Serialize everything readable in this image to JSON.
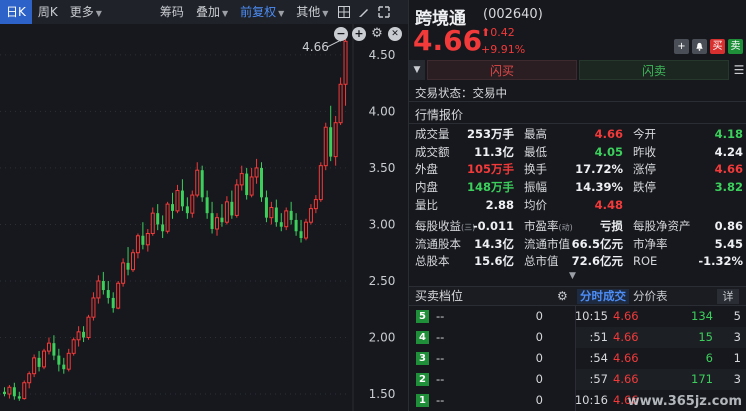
{
  "toolbar": {
    "items": [
      {
        "label": "日K",
        "active": true
      },
      {
        "label": "周K",
        "active": false
      },
      {
        "label": "更多",
        "dropdown": true
      }
    ],
    "mid_items": [
      {
        "label": "筹码"
      },
      {
        "label": "叠加",
        "dropdown": true
      },
      {
        "label": "前复权",
        "dropdown": true,
        "highlight": true
      },
      {
        "label": "其他",
        "dropdown": true
      }
    ],
    "icons": [
      "grid-icon",
      "pen-icon",
      "expand-icon"
    ]
  },
  "chart_data": {
    "type": "candlestick",
    "ylim": [
      1.35,
      4.72
    ],
    "y_ticks": [
      "4.50",
      "4.00",
      "3.50",
      "3.00",
      "2.50",
      "2.00",
      "1.50"
    ],
    "y_tick_values": [
      4.5,
      4.0,
      3.5,
      3.0,
      2.5,
      2.0,
      1.5
    ],
    "max_label": "4.66",
    "max_value": 4.66,
    "candles": [
      {
        "o": 1.52,
        "h": 1.56,
        "l": 1.48,
        "c": 1.5
      },
      {
        "o": 1.5,
        "h": 1.58,
        "l": 1.46,
        "c": 1.56
      },
      {
        "o": 1.56,
        "h": 1.6,
        "l": 1.45,
        "c": 1.48
      },
      {
        "o": 1.48,
        "h": 1.52,
        "l": 1.44,
        "c": 1.46
      },
      {
        "o": 1.46,
        "h": 1.62,
        "l": 1.45,
        "c": 1.6
      },
      {
        "o": 1.6,
        "h": 1.7,
        "l": 1.55,
        "c": 1.68
      },
      {
        "o": 1.68,
        "h": 1.85,
        "l": 1.65,
        "c": 1.82
      },
      {
        "o": 1.82,
        "h": 1.88,
        "l": 1.7,
        "c": 1.74
      },
      {
        "o": 1.74,
        "h": 1.9,
        "l": 1.72,
        "c": 1.88
      },
      {
        "o": 1.88,
        "h": 2.0,
        "l": 1.85,
        "c": 1.95
      },
      {
        "o": 1.95,
        "h": 2.02,
        "l": 1.8,
        "c": 1.84
      },
      {
        "o": 1.84,
        "h": 1.9,
        "l": 1.7,
        "c": 1.76
      },
      {
        "o": 1.76,
        "h": 1.82,
        "l": 1.68,
        "c": 1.72
      },
      {
        "o": 1.72,
        "h": 1.9,
        "l": 1.7,
        "c": 1.86
      },
      {
        "o": 1.86,
        "h": 2.0,
        "l": 1.84,
        "c": 1.98
      },
      {
        "o": 1.98,
        "h": 2.1,
        "l": 1.92,
        "c": 2.05
      },
      {
        "o": 2.05,
        "h": 2.1,
        "l": 1.96,
        "c": 2.0
      },
      {
        "o": 2.0,
        "h": 2.2,
        "l": 1.98,
        "c": 2.18
      },
      {
        "o": 2.18,
        "h": 2.4,
        "l": 2.15,
        "c": 2.35
      },
      {
        "o": 2.35,
        "h": 2.55,
        "l": 2.3,
        "c": 2.5
      },
      {
        "o": 2.5,
        "h": 2.58,
        "l": 2.38,
        "c": 2.42
      },
      {
        "o": 2.42,
        "h": 2.5,
        "l": 2.3,
        "c": 2.35
      },
      {
        "o": 2.35,
        "h": 2.4,
        "l": 2.22,
        "c": 2.26
      },
      {
        "o": 2.26,
        "h": 2.5,
        "l": 2.25,
        "c": 2.48
      },
      {
        "o": 2.48,
        "h": 2.7,
        "l": 2.45,
        "c": 2.66
      },
      {
        "o": 2.66,
        "h": 2.8,
        "l": 2.55,
        "c": 2.6
      },
      {
        "o": 2.6,
        "h": 2.78,
        "l": 2.58,
        "c": 2.75
      },
      {
        "o": 2.75,
        "h": 2.92,
        "l": 2.7,
        "c": 2.9
      },
      {
        "o": 2.9,
        "h": 3.02,
        "l": 2.78,
        "c": 2.82
      },
      {
        "o": 2.82,
        "h": 2.96,
        "l": 2.76,
        "c": 2.92
      },
      {
        "o": 2.92,
        "h": 3.15,
        "l": 2.9,
        "c": 3.1
      },
      {
        "o": 3.1,
        "h": 3.18,
        "l": 2.95,
        "c": 3.0
      },
      {
        "o": 3.0,
        "h": 3.08,
        "l": 2.88,
        "c": 2.94
      },
      {
        "o": 2.94,
        "h": 3.2,
        "l": 2.92,
        "c": 3.18
      },
      {
        "o": 3.18,
        "h": 3.28,
        "l": 3.05,
        "c": 3.12
      },
      {
        "o": 3.12,
        "h": 3.35,
        "l": 3.1,
        "c": 3.3
      },
      {
        "o": 3.3,
        "h": 3.4,
        "l": 3.12,
        "c": 3.16
      },
      {
        "o": 3.16,
        "h": 3.24,
        "l": 3.05,
        "c": 3.1
      },
      {
        "o": 3.1,
        "h": 3.3,
        "l": 3.06,
        "c": 3.26
      },
      {
        "o": 3.26,
        "h": 3.55,
        "l": 3.24,
        "c": 3.48
      },
      {
        "o": 3.48,
        "h": 3.52,
        "l": 3.2,
        "c": 3.24
      },
      {
        "o": 3.24,
        "h": 3.3,
        "l": 3.05,
        "c": 3.1
      },
      {
        "o": 3.1,
        "h": 3.2,
        "l": 2.92,
        "c": 2.96
      },
      {
        "o": 2.96,
        "h": 3.1,
        "l": 2.9,
        "c": 3.06
      },
      {
        "o": 3.06,
        "h": 3.18,
        "l": 2.98,
        "c": 3.02
      },
      {
        "o": 3.02,
        "h": 3.25,
        "l": 3.0,
        "c": 3.2
      },
      {
        "o": 3.2,
        "h": 3.3,
        "l": 3.05,
        "c": 3.08
      },
      {
        "o": 3.08,
        "h": 3.4,
        "l": 3.06,
        "c": 3.35
      },
      {
        "o": 3.35,
        "h": 3.52,
        "l": 3.3,
        "c": 3.45
      },
      {
        "o": 3.45,
        "h": 3.5,
        "l": 3.22,
        "c": 3.26
      },
      {
        "o": 3.26,
        "h": 3.5,
        "l": 3.24,
        "c": 3.42
      },
      {
        "o": 3.42,
        "h": 3.58,
        "l": 3.36,
        "c": 3.5
      },
      {
        "o": 3.5,
        "h": 3.55,
        "l": 3.2,
        "c": 3.24
      },
      {
        "o": 3.24,
        "h": 3.3,
        "l": 3.02,
        "c": 3.06
      },
      {
        "o": 3.06,
        "h": 3.2,
        "l": 3.0,
        "c": 3.15
      },
      {
        "o": 3.15,
        "h": 3.22,
        "l": 2.98,
        "c": 3.02
      },
      {
        "o": 3.02,
        "h": 3.1,
        "l": 2.94,
        "c": 2.98
      },
      {
        "o": 2.98,
        "h": 3.15,
        "l": 2.95,
        "c": 3.12
      },
      {
        "o": 3.12,
        "h": 3.2,
        "l": 3.0,
        "c": 3.04
      },
      {
        "o": 3.04,
        "h": 3.1,
        "l": 2.9,
        "c": 2.94
      },
      {
        "o": 2.94,
        "h": 3.04,
        "l": 2.84,
        "c": 2.88
      },
      {
        "o": 2.88,
        "h": 3.05,
        "l": 2.86,
        "c": 3.02
      },
      {
        "o": 3.02,
        "h": 3.18,
        "l": 3.0,
        "c": 3.14
      },
      {
        "o": 3.14,
        "h": 3.26,
        "l": 3.1,
        "c": 3.22
      },
      {
        "o": 3.22,
        "h": 3.55,
        "l": 3.2,
        "c": 3.52
      },
      {
        "o": 3.52,
        "h": 3.9,
        "l": 3.48,
        "c": 3.86
      },
      {
        "o": 3.86,
        "h": 4.05,
        "l": 3.56,
        "c": 3.6
      },
      {
        "o": 3.6,
        "h": 3.96,
        "l": 3.52,
        "c": 3.9
      },
      {
        "o": 3.9,
        "h": 4.3,
        "l": 3.88,
        "c": 4.24
      },
      {
        "o": 4.24,
        "h": 4.66,
        "l": 4.05,
        "c": 4.62
      }
    ]
  },
  "header": {
    "name": "跨境通",
    "code": "(002640)",
    "price": "4.66",
    "change": "0.42",
    "change_pct": "+9.91%",
    "buttons": [
      "+",
      "bell",
      "买",
      "卖"
    ]
  },
  "trade": {
    "buy_label": "闪买",
    "sell_label": "闪卖"
  },
  "status": "交易状态：交易中",
  "quote_title": "行情报价",
  "quotes": [
    [
      {
        "label": "成交量",
        "value": "253万手",
        "color": "white"
      },
      {
        "label": "最高",
        "value": "4.66",
        "color": "red"
      },
      {
        "label": "今开",
        "value": "4.18",
        "color": "green"
      }
    ],
    [
      {
        "label": "成交额",
        "value": "11.3亿",
        "color": "white"
      },
      {
        "label": "最低",
        "value": "4.05",
        "color": "green"
      },
      {
        "label": "昨收",
        "value": "4.24",
        "color": "white"
      }
    ],
    [
      {
        "label": "外盘",
        "value": "105万手",
        "color": "red"
      },
      {
        "label": "换手",
        "value": "17.72%",
        "color": "white"
      },
      {
        "label": "涨停",
        "value": "4.66",
        "color": "red"
      }
    ],
    [
      {
        "label": "内盘",
        "value": "148万手",
        "color": "green"
      },
      {
        "label": "振幅",
        "value": "14.39%",
        "color": "white"
      },
      {
        "label": "跌停",
        "value": "3.82",
        "color": "green"
      }
    ],
    [
      {
        "label": "量比",
        "value": "2.88",
        "color": "white"
      },
      {
        "label": "均价",
        "value": "4.48",
        "color": "red"
      },
      {
        "label": "",
        "value": "",
        "color": "white"
      }
    ]
  ],
  "ext": [
    [
      {
        "label": "每股收益",
        "sup": "(三)",
        "value": "-0.011",
        "color": "white"
      },
      {
        "label": "市盈率",
        "sup": "(动)",
        "value": "亏损",
        "color": "white"
      },
      {
        "label": "每股净资产",
        "value": "0.86",
        "color": "white"
      }
    ],
    [
      {
        "label": "流通股本",
        "value": "14.3亿",
        "color": "white"
      },
      {
        "label": "流通市值",
        "value": "66.5亿元",
        "color": "white"
      },
      {
        "label": "市净率",
        "value": "5.45",
        "color": "white"
      }
    ],
    [
      {
        "label": "总股本",
        "value": "15.6亿",
        "color": "white"
      },
      {
        "label": "总市值",
        "value": "72.6亿元",
        "color": "white"
      },
      {
        "label": "ROE",
        "value": "-1.32%",
        "color": "white"
      }
    ]
  ],
  "lower": {
    "book_title": "买卖档位",
    "tab_active": "分时成交",
    "tab_other": "分价表",
    "detail": "详"
  },
  "book": [
    {
      "level": "5",
      "price": "--",
      "vol": "0"
    },
    {
      "level": "4",
      "price": "--",
      "vol": "0"
    },
    {
      "level": "3",
      "price": "--",
      "vol": "0"
    },
    {
      "level": "2",
      "price": "--",
      "vol": "0"
    },
    {
      "level": "1",
      "price": "--",
      "vol": "0"
    }
  ],
  "ticks": [
    {
      "time": "10:15",
      "price": "4.66",
      "vol": "134",
      "vcolor": "green",
      "cnt": "5"
    },
    {
      "time": ":51",
      "price": "4.66",
      "vol": "15",
      "vcolor": "green",
      "cnt": "3"
    },
    {
      "time": ":54",
      "price": "4.66",
      "vol": "6",
      "vcolor": "green",
      "cnt": "1"
    },
    {
      "time": ":57",
      "price": "4.66",
      "vol": "171",
      "vcolor": "green",
      "cnt": "3"
    },
    {
      "time": "10:16",
      "price": "4.66",
      "vol": "",
      "vcolor": "green",
      "cnt": ""
    }
  ],
  "watermark": "www.365jz.com",
  "colors": {
    "up": "#f23a3a",
    "down": "#3ccf5c",
    "bg": "#16181d"
  }
}
